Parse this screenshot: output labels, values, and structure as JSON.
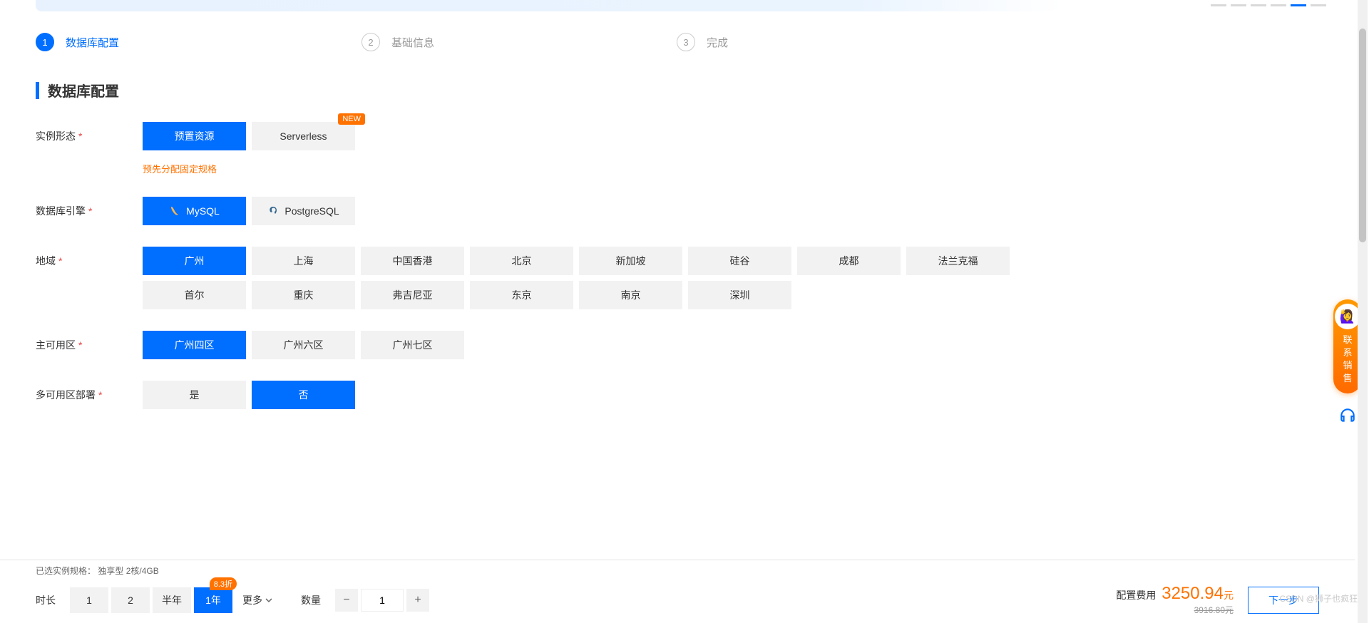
{
  "steps": [
    {
      "num": "1",
      "label": "数据库配置",
      "active": true
    },
    {
      "num": "2",
      "label": "基础信息",
      "active": false
    },
    {
      "num": "3",
      "label": "完成",
      "active": false
    }
  ],
  "section_title": "数据库配置",
  "form": {
    "instance_type": {
      "label": "实例形态",
      "options": [
        "预置资源",
        "Serverless"
      ],
      "selected": 0,
      "badge": "NEW",
      "hint": "预先分配固定规格"
    },
    "db_engine": {
      "label": "数据库引擎",
      "options": [
        "MySQL",
        "PostgreSQL"
      ],
      "selected": 0
    },
    "region": {
      "label": "地域",
      "row1": [
        "广州",
        "上海",
        "中国香港",
        "北京",
        "新加坡",
        "硅谷",
        "成都",
        "法兰克福"
      ],
      "row2": [
        "首尔",
        "重庆",
        "弗吉尼亚",
        "东京",
        "南京",
        "深圳"
      ],
      "selected": "广州"
    },
    "primary_az": {
      "label": "主可用区",
      "options": [
        "广州四区",
        "广州六区",
        "广州七区"
      ],
      "selected": 0
    },
    "multi_az": {
      "label": "多可用区部署",
      "options": [
        "是",
        "否"
      ],
      "selected": 1
    }
  },
  "footer": {
    "selected_spec_label": "已选实例规格：",
    "selected_spec_value": "独享型 2核/4GB",
    "duration_label": "时长",
    "durations": [
      "1",
      "2",
      "半年",
      "1年"
    ],
    "duration_selected": 3,
    "duration_discount": "8.3折",
    "duration_more": "更多",
    "qty_label": "数量",
    "qty_value": "1",
    "price_label": "配置费用",
    "price_value": "3250.94",
    "price_unit": "元",
    "price_old": "3916.80元",
    "next": "下一步"
  },
  "float": {
    "sales": [
      "联",
      "系",
      "销",
      "售"
    ]
  },
  "watermark": "CSDN @狮子也疯狂"
}
